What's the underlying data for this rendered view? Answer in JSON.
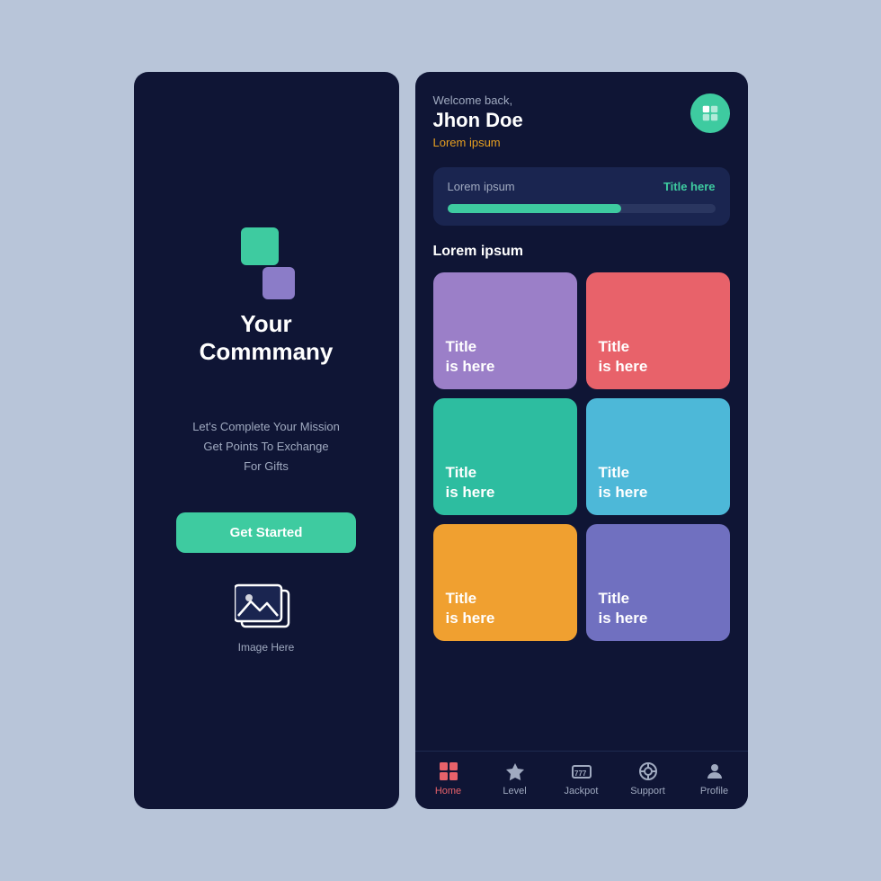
{
  "screen1": {
    "company_name": "Your\nCommmany",
    "tagline": "Let's Complete Your Mission\nGet Points To Exchange\nFor Gifts",
    "get_started_label": "Get Started",
    "image_label": "Image Here",
    "logo_colors": {
      "green": "#3ecba0",
      "purple": "#8b7cc8"
    }
  },
  "screen2": {
    "header": {
      "welcome_text": "Welcome back,",
      "user_name": "Jhon Doe",
      "subtitle": "Lorem ipsum"
    },
    "progress_card": {
      "label": "Lorem ipsum",
      "title": "Title here",
      "progress_percent": 65
    },
    "section_label": "Lorem ipsum",
    "grid_items": [
      {
        "id": "card1",
        "title": "Title\nis here",
        "color": "#9b7fc8"
      },
      {
        "id": "card2",
        "title": "Title\nis here",
        "color": "#e8626a"
      },
      {
        "id": "card3",
        "title": "Title\nis here",
        "color": "#2dbda0"
      },
      {
        "id": "card4",
        "title": "Title\nis here",
        "color": "#4db8d8"
      },
      {
        "id": "card5",
        "title": "Title\nis here",
        "color": "#f0a030"
      },
      {
        "id": "card6",
        "title": "Title\nis here",
        "color": "#7070c0"
      }
    ],
    "nav": {
      "items": [
        {
          "id": "home",
          "label": "Home",
          "active": true
        },
        {
          "id": "level",
          "label": "Level",
          "active": false
        },
        {
          "id": "jackpot",
          "label": "Jackpot",
          "active": false
        },
        {
          "id": "support",
          "label": "Support",
          "active": false
        },
        {
          "id": "profile",
          "label": "Profile",
          "active": false
        }
      ]
    }
  }
}
